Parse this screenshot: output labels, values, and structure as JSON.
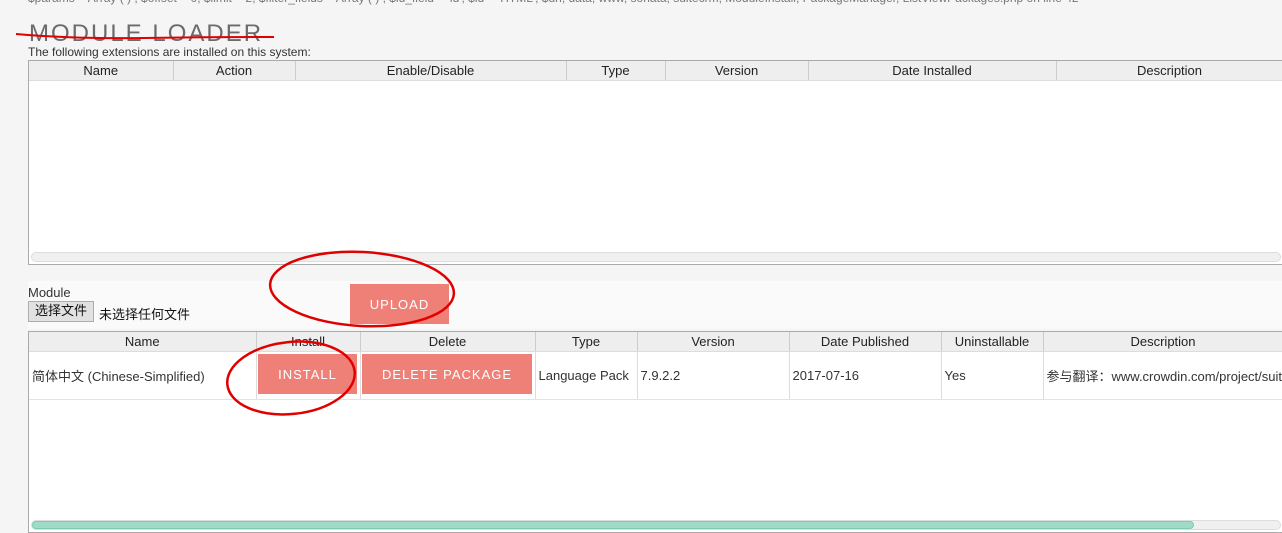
{
  "page": {
    "title": "MODULE LOADER",
    "installed_caption": "The following extensions are installed on this system:"
  },
  "installed_table": {
    "headers": [
      "Name",
      "Action",
      "Enable/Disable",
      "Type",
      "Version",
      "Date Installed",
      "Description"
    ],
    "rows": []
  },
  "upload": {
    "module_label": "Module",
    "choose_file_label": "选择文件",
    "no_file_text": "未选择任何文件",
    "upload_label": "UPLOAD"
  },
  "packages_table": {
    "headers": [
      "Name",
      "Install",
      "Delete",
      "Type",
      "Version",
      "Date Published",
      "Uninstallable",
      "Description"
    ],
    "rows": [
      {
        "name": "简体中文 (Chinese-Simplified)",
        "install_label": "INSTALL",
        "delete_label": "DELETE PACKAGE",
        "type": "Language Pack",
        "version": "7.9.2.2",
        "date_published": "2017-07-16",
        "uninstallable": "Yes",
        "description": "参与翻译：www.crowdin.com/project/suit"
      }
    ]
  },
  "colors": {
    "button": "#ef8077",
    "annotation": "#e00000",
    "scroll_thumb": "#9fdcc6"
  }
}
